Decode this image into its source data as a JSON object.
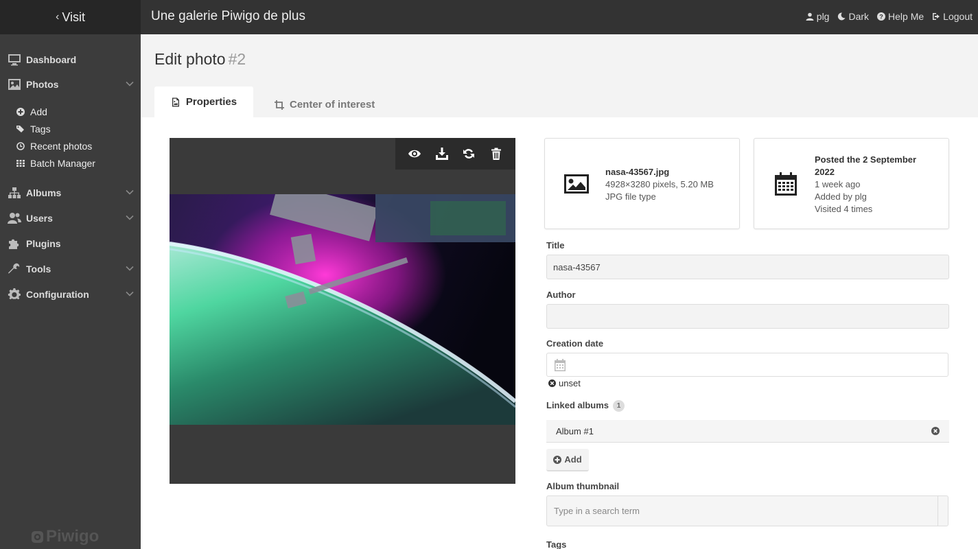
{
  "topbar": {
    "visit_label": "Visit",
    "gallery_title": "Une galerie Piwigo de plus",
    "links": {
      "user": "plg",
      "theme": "Dark",
      "help": "Help Me",
      "logout": "Logout"
    }
  },
  "sidebar": {
    "dashboard": "Dashboard",
    "photos": "Photos",
    "photos_sub": {
      "add": "Add",
      "tags": "Tags",
      "recent": "Recent photos",
      "batch": "Batch Manager"
    },
    "albums": "Albums",
    "users": "Users",
    "plugins": "Plugins",
    "tools": "Tools",
    "configuration": "Configuration",
    "brand": "Piwigo"
  },
  "header": {
    "title": "Edit photo",
    "photo_number": "#2",
    "tabs": {
      "properties": "Properties",
      "center": "Center of interest"
    }
  },
  "file_card": {
    "filename": "nasa-43567.jpg",
    "dimensions": "4928×3280 pixels, 5.20 MB",
    "type": "JPG file type"
  },
  "date_card": {
    "posted": "Posted the 2 September 2022",
    "ago": "1 week ago",
    "added_by": "Added by plg",
    "visited": "Visited 4 times"
  },
  "form": {
    "title_label": "Title",
    "title_value": "nasa-43567",
    "author_label": "Author",
    "author_value": "",
    "creation_label": "Creation date",
    "unset_label": "unset",
    "linked_label": "Linked albums",
    "linked_count": "1",
    "album_chip": "Album #1",
    "add_label": "Add",
    "thumb_label": "Album thumbnail",
    "thumb_placeholder": "Type in a search term",
    "tags_label": "Tags"
  },
  "colors": {
    "topbar": "#333333",
    "sidebar": "#3c3c3c",
    "visit_bg": "#262626",
    "head_bg": "#f3f3f3"
  }
}
